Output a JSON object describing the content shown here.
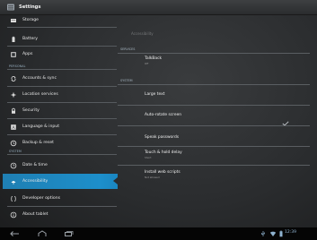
{
  "app": {
    "title": "Settings",
    "icon": "settings-icon"
  },
  "left_nav": {
    "items": [
      {
        "label": "Storage",
        "icon": "storage-icon"
      },
      {
        "label": "Battery",
        "icon": "battery-icon"
      },
      {
        "label": "Apps",
        "icon": "apps-icon"
      },
      {
        "label": "Accounts & sync",
        "icon": "sync-icon"
      },
      {
        "label": "Location services",
        "icon": "location-icon"
      },
      {
        "label": "Security",
        "icon": "lock-icon"
      },
      {
        "label": "Language & input",
        "icon": "keyboard-icon"
      },
      {
        "label": "Backup & reset",
        "icon": "backup-icon"
      },
      {
        "label": "Date & time",
        "icon": "clock-icon"
      },
      {
        "label": "Accessibility",
        "icon": "accessibility-icon"
      },
      {
        "label": "Developer options",
        "icon": "developer-icon"
      },
      {
        "label": "About tablet",
        "icon": "info-icon"
      }
    ],
    "sections": {
      "personal": "PERSONAL",
      "system": "SYSTEM"
    },
    "selected": "Accessibility"
  },
  "detail": {
    "title": "Accessibility",
    "sections": {
      "services": "SERVICES",
      "system": "SYSTEM"
    },
    "items": [
      {
        "title": "TalkBack",
        "subtitle": "Off"
      },
      {
        "title": "Large text",
        "subtitle": ""
      },
      {
        "title": "Auto-rotate screen",
        "subtitle": "",
        "checked": true
      },
      {
        "title": "Speak passwords",
        "subtitle": ""
      },
      {
        "title": "Touch & hold delay",
        "subtitle": "Short"
      },
      {
        "title": "Install web scripts",
        "subtitle": "Not allowed"
      }
    ]
  },
  "system_bar": {
    "buttons": [
      "back-icon",
      "home-icon",
      "recent-apps-icon"
    ],
    "status_icons": [
      "usb-icon",
      "wifi-icon",
      "battery-status-icon"
    ],
    "time": "12:39"
  },
  "colors": {
    "accent": "#1d8fcb",
    "background": "#2c2e30",
    "section_header": "#9fb8c9"
  }
}
